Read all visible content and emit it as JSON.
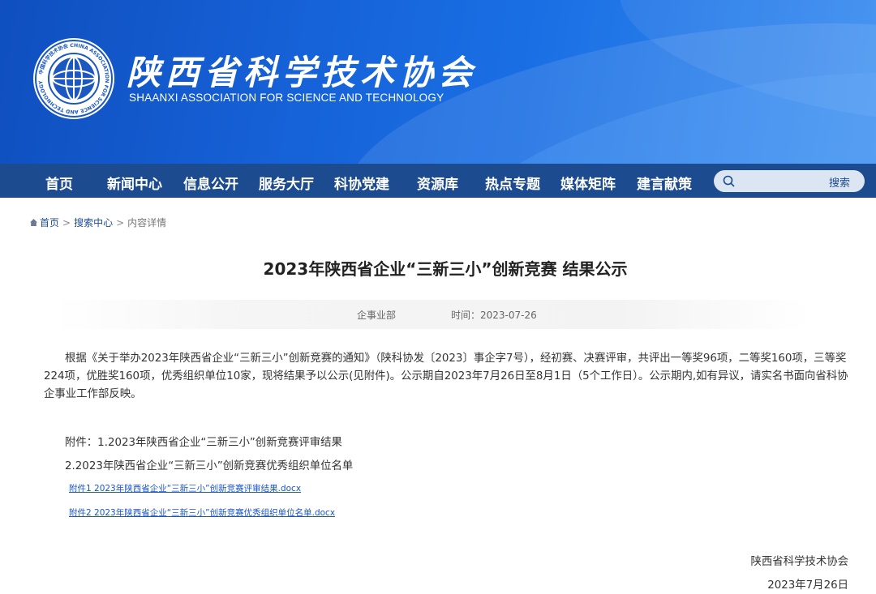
{
  "header": {
    "site_name_cn": "陕西省科学技术协会",
    "site_name_en": "SHAANXI ASSOCIATION FOR SCIENCE AND TECHNOLOGY",
    "logo_ring_text": "中国科学技术协会 CHINA ASSOCIATION FOR SCIENCE AND TECHNOLOGY",
    "colors": {
      "banner": "#1662d8",
      "nav": "#1c4b8f"
    }
  },
  "nav": {
    "items": [
      {
        "label": "首页"
      },
      {
        "label": "新闻中心"
      },
      {
        "label": "信息公开"
      },
      {
        "label": "服务大厅"
      },
      {
        "label": "科协党建"
      },
      {
        "label": "资源库"
      },
      {
        "label": "热点专题"
      },
      {
        "label": "媒体矩阵"
      },
      {
        "label": "建言献策"
      }
    ],
    "search_button": "搜索",
    "search_icon": "search-icon"
  },
  "breadcrumb": {
    "home": "首页",
    "sep": ">",
    "search_center": "搜索中心",
    "current": "内容详情"
  },
  "article": {
    "title": "2023年陕西省企业“三新三小”创新竞赛 结果公示",
    "department": "企事业部",
    "time": "时间：2023-07-26",
    "body": "根据《关于举办2023年陕西省企业“三新三小”创新竞赛的通知》（陕科协发〔2023〕事企字7号），经初赛、决赛评审，共评出一等奖96项，二等奖160项，三等奖224项，优胜奖160项，优秀组织单位10家，现将结果予以公示(见附件)。公示期自2023年7月26日至8月1日（5个工作日）。公示期内,如有异议，请实名书面向省科协企事业工作部反映。",
    "attachments": [
      "附件：1.2023年陕西省企业“三新三小”创新竞赛评审结果",
      "2.2023年陕西省企业“三新三小”创新竞赛优秀组织单位名单"
    ],
    "files": [
      "附件1 2023年陕西省企业“三新三小”创新竞赛评审结果.docx",
      "附件2 2023年陕西省企业“三新三小”创新竞赛优秀组织单位名单.docx"
    ],
    "signature_org": "陕西省科学技术协会",
    "signature_date": "2023年7月26日"
  }
}
